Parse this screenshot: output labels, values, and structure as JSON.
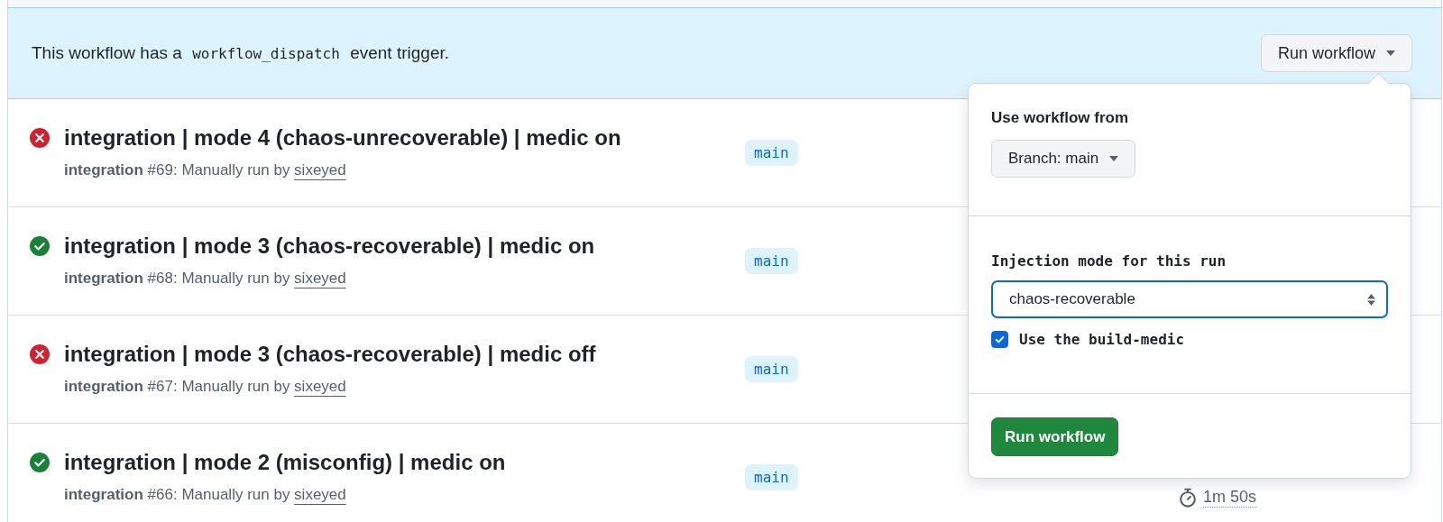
{
  "banner": {
    "before": "This workflow has a ",
    "code": "workflow_dispatch",
    "after": " event trigger.",
    "button": "Run workflow"
  },
  "runs": [
    {
      "kind": "failure",
      "title": "integration | mode 4 (chaos-unrecoverable) | medic on",
      "workflow": "integration",
      "number": "#69",
      "trigger": ": Manually run by ",
      "actor": "sixeyed",
      "branch": "main"
    },
    {
      "kind": "success",
      "title": "integration | mode 3 (chaos-recoverable) | medic on",
      "workflow": "integration",
      "number": "#68",
      "trigger": ": Manually run by ",
      "actor": "sixeyed",
      "branch": "main"
    },
    {
      "kind": "failure",
      "title": "integration | mode 3 (chaos-recoverable) | medic off",
      "workflow": "integration",
      "number": "#67",
      "trigger": ": Manually run by ",
      "actor": "sixeyed",
      "branch": "main"
    },
    {
      "kind": "success",
      "title": "integration | mode 2 (misconfig) | medic on",
      "workflow": "integration",
      "number": "#66",
      "trigger": ": Manually run by ",
      "actor": "sixeyed",
      "branch": "main",
      "duration": "1m 50s"
    }
  ],
  "popover": {
    "heading": "Use workflow from",
    "branch_button": "Branch: main",
    "input_label": "Injection mode for this run",
    "select_value": "chaos-recoverable",
    "checkbox": {
      "label": "Use the build-medic",
      "checked": true
    },
    "submit": "Run workflow"
  }
}
